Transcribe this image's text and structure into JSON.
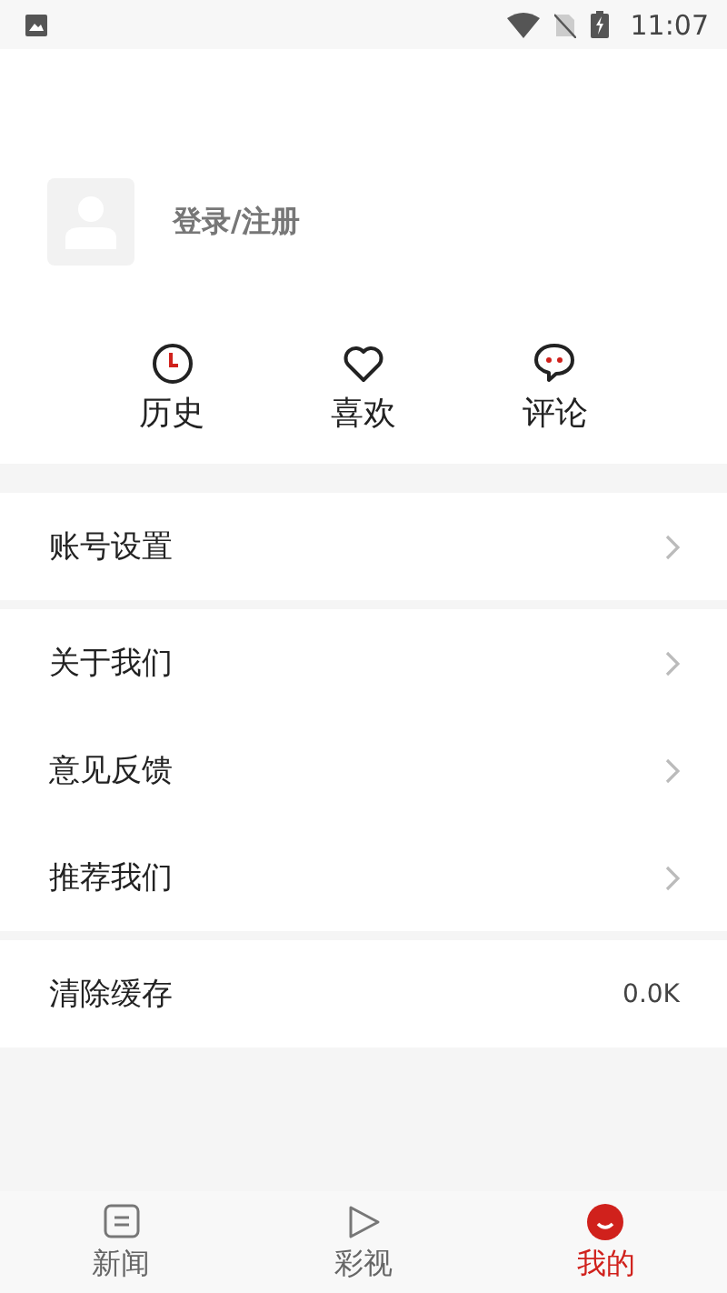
{
  "status_bar": {
    "time": "11:07"
  },
  "profile": {
    "login_label": "登录/注册"
  },
  "shortcuts": [
    {
      "label": "历史",
      "kind": "history"
    },
    {
      "label": "喜欢",
      "kind": "like"
    },
    {
      "label": "评论",
      "kind": "comment"
    }
  ],
  "menu_groups": [
    [
      {
        "label": "账号设置",
        "kind": "link"
      }
    ],
    [
      {
        "label": "关于我们",
        "kind": "link"
      },
      {
        "label": "意见反馈",
        "kind": "link"
      },
      {
        "label": "推荐我们",
        "kind": "link"
      }
    ],
    [
      {
        "label": "清除缓存",
        "kind": "value",
        "value": "0.0K"
      }
    ]
  ],
  "tabs": [
    {
      "label": "新闻",
      "kind": "news",
      "selected": false
    },
    {
      "label": "彩视",
      "kind": "video",
      "selected": false
    },
    {
      "label": "我的",
      "kind": "me",
      "selected": true
    }
  ]
}
